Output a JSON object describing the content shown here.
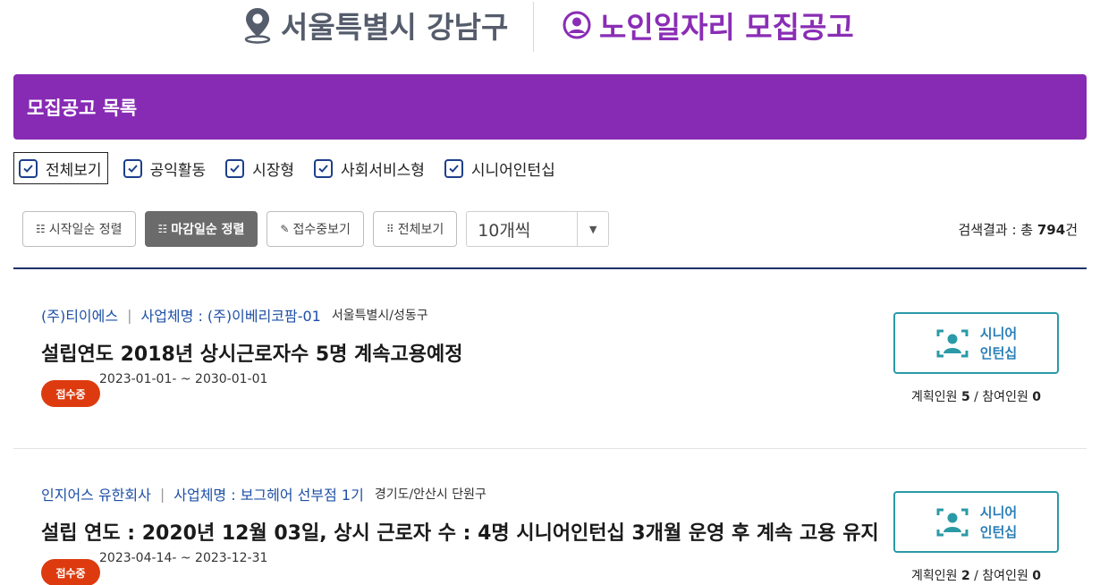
{
  "header": {
    "region": "서울특별시 강남구",
    "title": "노인일자리 모집공고",
    "region_icon": "location-pin-icon",
    "title_icon": "user-circle-icon"
  },
  "section": {
    "title": "모집공고 목록"
  },
  "filters": [
    {
      "label": "전체보기",
      "checked": true
    },
    {
      "label": "공익활동",
      "checked": true
    },
    {
      "label": "시장형",
      "checked": true
    },
    {
      "label": "사회서비스형",
      "checked": true
    },
    {
      "label": "시니어인턴십",
      "checked": true
    }
  ],
  "toolbar": {
    "sort_start": "시작일순 정렬",
    "sort_end": "마감일순 정렬",
    "filter_open": "접수중보기",
    "view_all": "전체보기",
    "page_size": "10개씩",
    "result_prefix": "검색결과 : 총 ",
    "result_count": "794",
    "result_suffix": "건"
  },
  "jobs": [
    {
      "company": "(주)티이에스",
      "business": "사업체명 : (주)이베리코팜-01",
      "region": "서울특별시/성동구",
      "title": "설립연도 2018년 상시근로자수 5명 계속고용예정",
      "status": "접수중",
      "period": "2023-01-01- ~ 2030-01-01",
      "type_line1": "시니어",
      "type_line2": "인턴십",
      "planned_label": "계획인원 ",
      "planned": "5",
      "joined_label": " / 참여인원 ",
      "joined": "0"
    },
    {
      "company": "인지어스 유한회사",
      "business": "사업체명 : 보그헤어 선부점 1기",
      "region": "경기도/안산시 단원구",
      "title": "설립 연도 : 2020년 12월 03일, 상시 근로자 수 : 4명 시니어인턴십 3개월 운영 후 계속 고용 유지",
      "status": "접수중",
      "period": "2023-04-14- ~ 2023-12-31",
      "type_line1": "시니어",
      "type_line2": "인턴십",
      "planned_label": "계획인원 ",
      "planned": "2",
      "joined_label": " / 참여인원 ",
      "joined": "0"
    }
  ],
  "colors": {
    "brand_purple": "#872bb4",
    "status_orange": "#dd3b0f",
    "teal": "#2a9aa6",
    "link_blue": "#1d4fa6"
  }
}
